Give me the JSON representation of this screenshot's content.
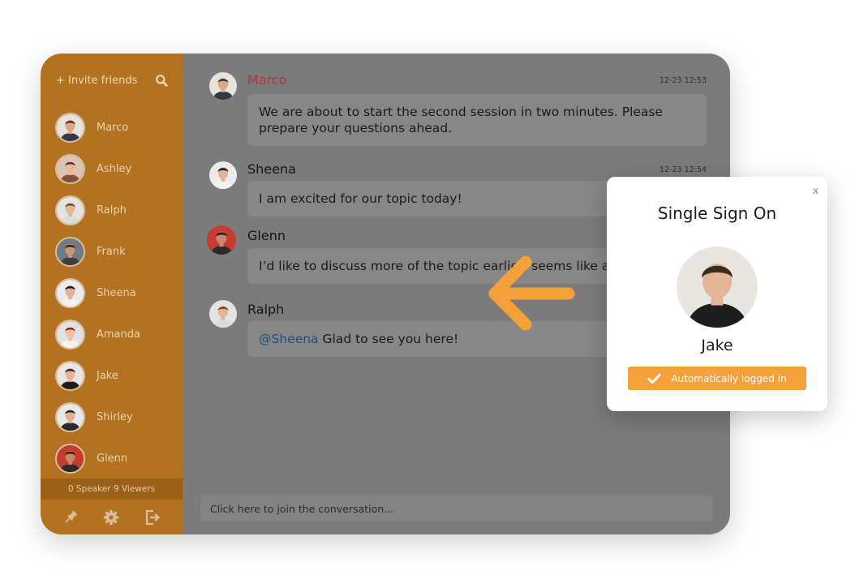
{
  "sidebar": {
    "invite_label": "+ Invite friends",
    "users": [
      {
        "name": "Marco",
        "skin": "#d9a98a",
        "hair": "#4a3426",
        "shirt": "#2f3a44",
        "bg": "#e7e2dc"
      },
      {
        "name": "Ashley",
        "skin": "#e9b89a",
        "hair": "#5a3423",
        "shirt": "#8a4f3c",
        "bg": "#d9c4b5"
      },
      {
        "name": "Ralph",
        "skin": "#e6b797",
        "hair": "#6e4c34",
        "shirt": "#dcdcdc",
        "bg": "#e4e4e4"
      },
      {
        "name": "Frank",
        "skin": "#c99477",
        "hair": "#2c2520",
        "shirt": "#3a3f44",
        "bg": "#6f7d82"
      },
      {
        "name": "Sheena",
        "skin": "#e3b195",
        "hair": "#1f1a18",
        "shirt": "#f2f2f2",
        "bg": "#ebebeb"
      },
      {
        "name": "Amanda",
        "skin": "#f0c2a4",
        "hair": "#7a2c1e",
        "shirt": "#f4f4f4",
        "bg": "#e2e2e2"
      },
      {
        "name": "Jake",
        "skin": "#e4b496",
        "hair": "#3b2a20",
        "shirt": "#1d1d1d",
        "bg": "#e9e6e2"
      },
      {
        "name": "Shirley",
        "skin": "#e2b08f",
        "hair": "#222222",
        "shirt": "#2a2a2a",
        "bg": "#e8e8e8"
      },
      {
        "name": "Glenn",
        "skin": "#c48a67",
        "hair": "#2b211c",
        "shirt": "#2b2b2b",
        "bg": "#c63b2e"
      }
    ],
    "viewers_label": "0 Speaker 9 Viewers"
  },
  "chat": {
    "messages": [
      {
        "author": "Marco",
        "author_color": "#b8343c",
        "time": "12-23 12:53",
        "text": "We are about to start the second session in two minutes. Please prepare your questions ahead."
      },
      {
        "author": "Sheena",
        "author_color": "#151515",
        "time": "12-23 12:54",
        "text": "I am excited for our topic today!"
      },
      {
        "author": "Glenn",
        "author_color": "#151515",
        "time": "",
        "text": "I’d like to discuss more of the topic earlier, seems like a"
      },
      {
        "author": "Ralph",
        "author_color": "#151515",
        "time": "",
        "mention": "@Sheena",
        "text": "Glad to see you here!"
      }
    ],
    "composer_placeholder": "Click here to join the conversation..."
  },
  "modal": {
    "close_label": "x",
    "title": "Single Sign On",
    "user_name": "Jake",
    "button_label": "Automatically logged in"
  },
  "colors": {
    "sidebar": "#b2721f",
    "accent": "#f5a13a",
    "chat_bg": "#7b7b7b",
    "author_highlight": "#b8343c",
    "mention": "#1f4f7f"
  }
}
